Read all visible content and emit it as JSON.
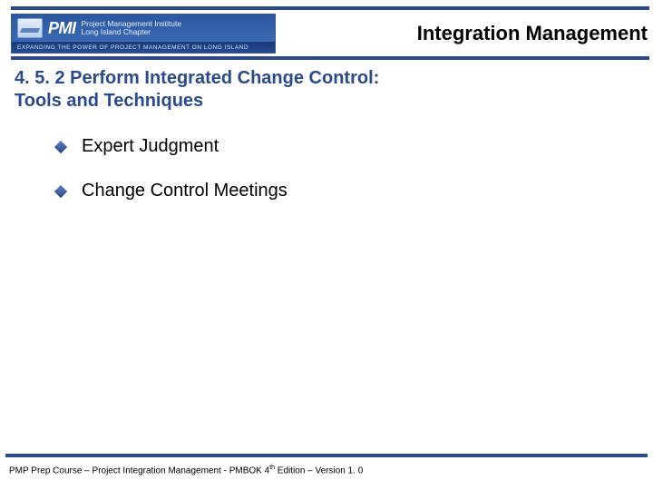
{
  "logo": {
    "pmi": "PMI",
    "line1": "Project Management Institute",
    "line2": "Long Island Chapter",
    "tagline": "Expanding the Power of Project Management on Long Island"
  },
  "header": {
    "title": "Integration Management"
  },
  "section": {
    "number_title": "4. 5. 2 Perform Integrated Change Control:",
    "subtitle": "Tools and Techniques"
  },
  "bullets": [
    "Expert Judgment",
    "Change Control Meetings"
  ],
  "footer": {
    "pre": "PMP Prep Course – Project Integration Management - PMBOK 4",
    "sup": "th",
    "post": " Edition – Version 1. 0"
  }
}
